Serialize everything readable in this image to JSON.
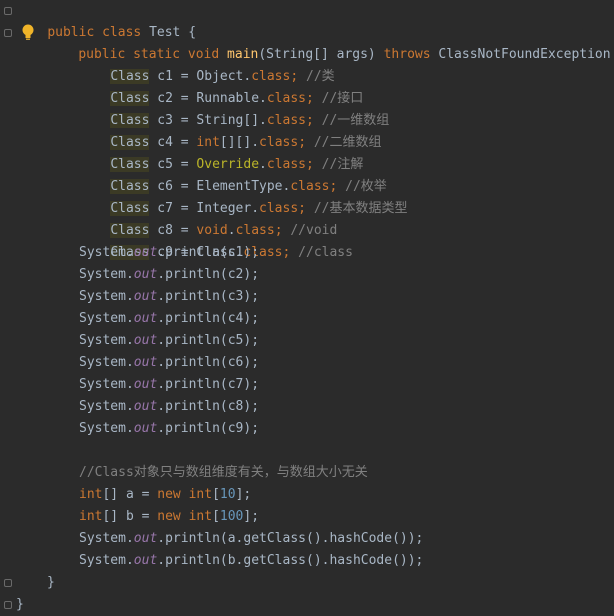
{
  "code": {
    "l1": [
      "public",
      "class",
      "Test {"
    ],
    "l2": [
      "public",
      "static",
      "void",
      "main",
      "(String[] args) ",
      "throws",
      " ClassNotFoundException {"
    ],
    "c1": [
      "Class",
      " c1 = Object.",
      "class",
      ";",
      " //类"
    ],
    "c2": [
      "Class",
      " c2 = Runnable.",
      "class",
      ";",
      " //接口"
    ],
    "c3": [
      "Class",
      " c3 = String[].",
      "class",
      ";",
      " //一维数组"
    ],
    "c4": [
      "Class",
      " c4 = ",
      "int",
      "[][].",
      "class",
      ";",
      " //二维数组"
    ],
    "c5": [
      "Class",
      " c5 = ",
      "Override",
      ".",
      "class",
      ";",
      " //注解"
    ],
    "c6": [
      "Class",
      " c6 = ElementType.",
      "class",
      ";",
      " //枚举"
    ],
    "c7": [
      "Class",
      " c7 = Integer.",
      "class",
      ";",
      " //基本数据类型"
    ],
    "c8": [
      "Class",
      " c8 = ",
      "void",
      ".",
      "class",
      ";",
      " //void"
    ],
    "c9": [
      "Class",
      " c9 = Class.",
      "class",
      ";",
      " //class"
    ],
    "println_prefix": "System.",
    "out": "out",
    "println_args": [
      ".println(c1);",
      ".println(c2);",
      ".println(c3);",
      ".println(c4);",
      ".println(c5);",
      ".println(c6);",
      ".println(c7);",
      ".println(c8);",
      ".println(c9);"
    ],
    "comment_line": "//Class对象只与数组维度有关，与数组大小无关",
    "a_line": [
      "int",
      "[] a = ",
      "new",
      " ",
      "int",
      "[",
      "10",
      "];"
    ],
    "b_line": [
      "int",
      "[] b = ",
      "new",
      " ",
      "int",
      "[",
      "100",
      "];"
    ],
    "hash_a": ".println(a.getClass().hashCode());",
    "hash_b": ".println(b.getClass().hashCode());",
    "close_inner": "}",
    "close_outer": "}"
  },
  "colors": {
    "background": "#2b2b2b",
    "keyword": "#cc7832",
    "method": "#ffc66d",
    "number": "#6897bb",
    "static_field": "#9876aa",
    "comment": "#808080",
    "annotation": "#bbb529",
    "highlight": "#3b3a25"
  },
  "icons": {
    "intention": "lightbulb-icon",
    "fold": "fold-marker-icon"
  }
}
